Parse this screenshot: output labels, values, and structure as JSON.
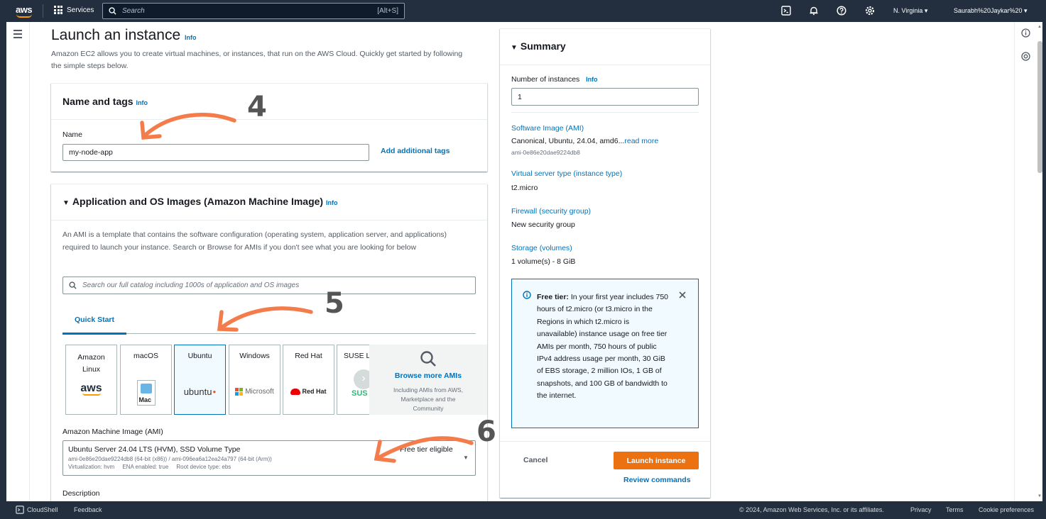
{
  "topnav": {
    "logo": "aws",
    "services": "Services",
    "search_placeholder": "Search",
    "search_shortcut": "[Alt+S]",
    "region": "N. Virginia ▾",
    "user": "Saurabh%20Jaykar%20 ▾"
  },
  "page": {
    "title": "Launch an instance",
    "info": "Info",
    "description": "Amazon EC2 allows you to create virtual machines, or instances, that run on the AWS Cloud. Quickly get started by following the simple steps below."
  },
  "name_tags": {
    "heading": "Name and tags",
    "info": "Info",
    "name_label": "Name",
    "name_value": "my-node-app",
    "add_tags": "Add additional tags"
  },
  "ami": {
    "heading": "Application and OS Images (Amazon Machine Image)",
    "info": "Info",
    "description": "An AMI is a template that contains the software configuration (operating system, application server, and applications) required to launch your instance. Search or Browse for AMIs if you don't see what you are looking for below",
    "search_placeholder": "Search our full catalog including 1000s of application and OS images",
    "tab": "Quick Start",
    "os_options": [
      {
        "label": "Amazon Linux",
        "logo": "aws"
      },
      {
        "label": "macOS",
        "logo": "Mac"
      },
      {
        "label": "Ubuntu",
        "logo": "ubuntu"
      },
      {
        "label": "Windows",
        "logo": "Microsoft"
      },
      {
        "label": "Red Hat",
        "logo": "Red Hat"
      },
      {
        "label": "SUSE Li",
        "logo": "SUS"
      }
    ],
    "browse_more": "Browse more AMIs",
    "browse_sub": "Including AMIs from AWS, Marketplace and the Community",
    "ami_label": "Amazon Machine Image (AMI)",
    "ami_name": "Ubuntu Server 24.04 LTS (HVM), SSD Volume Type",
    "ami_ids": "ami-0e86e20dae9224db8 (64-bit (x86)) / ami-096ea6a12ea24a797 (64-bit (Arm))",
    "ami_meta": "Virtualization: hvm     ENA enabled: true     Root device type: ebs",
    "free_tier_eligible": "Free tier eligible",
    "description_label": "Description"
  },
  "summary": {
    "heading": "Summary",
    "num_instances_label": "Number of instances",
    "info": "Info",
    "num_instances_value": "1",
    "software_image_label": "Software Image (AMI)",
    "software_image_value": "Canonical, Ubuntu, 24.04, amd6...",
    "read_more": "read more",
    "software_image_id": "ami-0e86e20dae9224db8",
    "server_type_label": "Virtual server type (instance type)",
    "server_type_value": "t2.micro",
    "firewall_label": "Firewall (security group)",
    "firewall_value": "New security group",
    "storage_label": "Storage (volumes)",
    "storage_value": "1 volume(s) - 8 GiB",
    "free_tier_title": "Free tier:",
    "free_tier_text": "In your first year includes 750 hours of t2.micro (or t3.micro in the Regions in which t2.micro is unavailable) instance usage on free tier AMIs per month, 750 hours of public IPv4 address usage per month, 30 GiB of EBS storage, 2 million IOs, 1 GB of snapshots, and 100 GB of bandwidth to the internet.",
    "cancel": "Cancel",
    "launch": "Launch instance",
    "review": "Review commands"
  },
  "annotations": {
    "step4": "4",
    "step5": "5",
    "step6": "6"
  },
  "footer": {
    "cloudshell": "CloudShell",
    "feedback": "Feedback",
    "copyright": "© 2024, Amazon Web Services, Inc. or its affiliates.",
    "privacy": "Privacy",
    "terms": "Terms",
    "cookies": "Cookie preferences"
  },
  "colors": {
    "nav": "#232f3e",
    "link": "#0073bb",
    "launch": "#ec7211",
    "annotation_arrow": "#f47c4a"
  }
}
